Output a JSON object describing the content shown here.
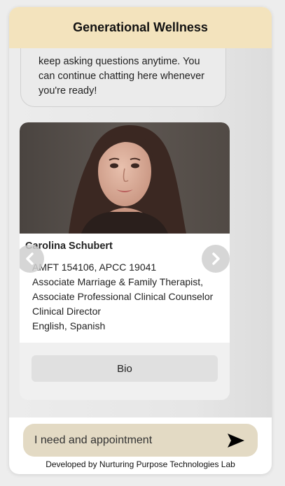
{
  "header": {
    "title": "Generational Wellness"
  },
  "chat": {
    "bubble_lines": [
      "keep asking questions anytime. You",
      "can continue chatting here whenever",
      "you're ready!"
    ]
  },
  "card": {
    "name": "Carolina Schubert",
    "details": [
      "AMFT 154106, APCC 19041",
      "Associate Marriage & Family Therapist,",
      "Associate Professional Clinical Counselor",
      "Clinical Director",
      "English, Spanish"
    ],
    "bio_label": "Bio"
  },
  "input": {
    "value": "I need and appointment"
  },
  "footer": {
    "text": "Developed by Nurturing Purpose Technologies Lab"
  },
  "colors": {
    "header_bg": "#f3e3bd",
    "input_bg": "#e3dac4"
  },
  "icons": {
    "prev": "chevron-left-icon",
    "next": "chevron-right-icon",
    "send": "send-arrow-icon"
  }
}
